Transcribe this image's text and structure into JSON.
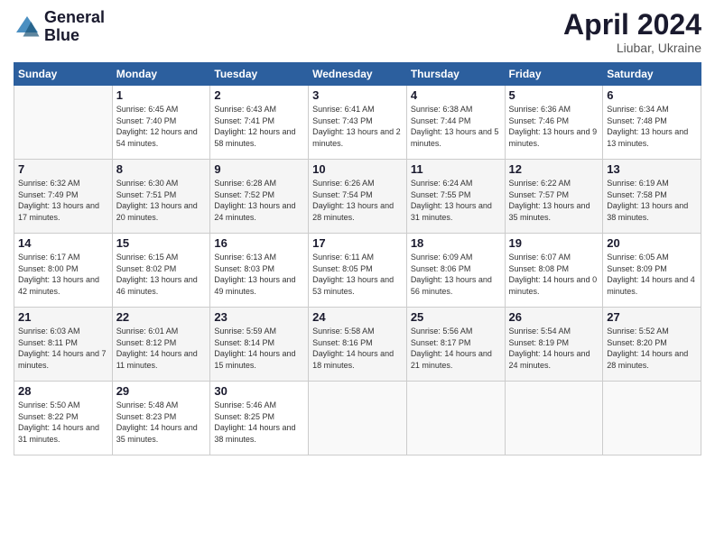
{
  "header": {
    "logo_line1": "General",
    "logo_line2": "Blue",
    "month_title": "April 2024",
    "location": "Liubar, Ukraine"
  },
  "weekdays": [
    "Sunday",
    "Monday",
    "Tuesday",
    "Wednesday",
    "Thursday",
    "Friday",
    "Saturday"
  ],
  "weeks": [
    [
      {
        "day": "",
        "sunrise": "",
        "sunset": "",
        "daylight": ""
      },
      {
        "day": "1",
        "sunrise": "Sunrise: 6:45 AM",
        "sunset": "Sunset: 7:40 PM",
        "daylight": "Daylight: 12 hours and 54 minutes."
      },
      {
        "day": "2",
        "sunrise": "Sunrise: 6:43 AM",
        "sunset": "Sunset: 7:41 PM",
        "daylight": "Daylight: 12 hours and 58 minutes."
      },
      {
        "day": "3",
        "sunrise": "Sunrise: 6:41 AM",
        "sunset": "Sunset: 7:43 PM",
        "daylight": "Daylight: 13 hours and 2 minutes."
      },
      {
        "day": "4",
        "sunrise": "Sunrise: 6:38 AM",
        "sunset": "Sunset: 7:44 PM",
        "daylight": "Daylight: 13 hours and 5 minutes."
      },
      {
        "day": "5",
        "sunrise": "Sunrise: 6:36 AM",
        "sunset": "Sunset: 7:46 PM",
        "daylight": "Daylight: 13 hours and 9 minutes."
      },
      {
        "day": "6",
        "sunrise": "Sunrise: 6:34 AM",
        "sunset": "Sunset: 7:48 PM",
        "daylight": "Daylight: 13 hours and 13 minutes."
      }
    ],
    [
      {
        "day": "7",
        "sunrise": "Sunrise: 6:32 AM",
        "sunset": "Sunset: 7:49 PM",
        "daylight": "Daylight: 13 hours and 17 minutes."
      },
      {
        "day": "8",
        "sunrise": "Sunrise: 6:30 AM",
        "sunset": "Sunset: 7:51 PM",
        "daylight": "Daylight: 13 hours and 20 minutes."
      },
      {
        "day": "9",
        "sunrise": "Sunrise: 6:28 AM",
        "sunset": "Sunset: 7:52 PM",
        "daylight": "Daylight: 13 hours and 24 minutes."
      },
      {
        "day": "10",
        "sunrise": "Sunrise: 6:26 AM",
        "sunset": "Sunset: 7:54 PM",
        "daylight": "Daylight: 13 hours and 28 minutes."
      },
      {
        "day": "11",
        "sunrise": "Sunrise: 6:24 AM",
        "sunset": "Sunset: 7:55 PM",
        "daylight": "Daylight: 13 hours and 31 minutes."
      },
      {
        "day": "12",
        "sunrise": "Sunrise: 6:22 AM",
        "sunset": "Sunset: 7:57 PM",
        "daylight": "Daylight: 13 hours and 35 minutes."
      },
      {
        "day": "13",
        "sunrise": "Sunrise: 6:19 AM",
        "sunset": "Sunset: 7:58 PM",
        "daylight": "Daylight: 13 hours and 38 minutes."
      }
    ],
    [
      {
        "day": "14",
        "sunrise": "Sunrise: 6:17 AM",
        "sunset": "Sunset: 8:00 PM",
        "daylight": "Daylight: 13 hours and 42 minutes."
      },
      {
        "day": "15",
        "sunrise": "Sunrise: 6:15 AM",
        "sunset": "Sunset: 8:02 PM",
        "daylight": "Daylight: 13 hours and 46 minutes."
      },
      {
        "day": "16",
        "sunrise": "Sunrise: 6:13 AM",
        "sunset": "Sunset: 8:03 PM",
        "daylight": "Daylight: 13 hours and 49 minutes."
      },
      {
        "day": "17",
        "sunrise": "Sunrise: 6:11 AM",
        "sunset": "Sunset: 8:05 PM",
        "daylight": "Daylight: 13 hours and 53 minutes."
      },
      {
        "day": "18",
        "sunrise": "Sunrise: 6:09 AM",
        "sunset": "Sunset: 8:06 PM",
        "daylight": "Daylight: 13 hours and 56 minutes."
      },
      {
        "day": "19",
        "sunrise": "Sunrise: 6:07 AM",
        "sunset": "Sunset: 8:08 PM",
        "daylight": "Daylight: 14 hours and 0 minutes."
      },
      {
        "day": "20",
        "sunrise": "Sunrise: 6:05 AM",
        "sunset": "Sunset: 8:09 PM",
        "daylight": "Daylight: 14 hours and 4 minutes."
      }
    ],
    [
      {
        "day": "21",
        "sunrise": "Sunrise: 6:03 AM",
        "sunset": "Sunset: 8:11 PM",
        "daylight": "Daylight: 14 hours and 7 minutes."
      },
      {
        "day": "22",
        "sunrise": "Sunrise: 6:01 AM",
        "sunset": "Sunset: 8:12 PM",
        "daylight": "Daylight: 14 hours and 11 minutes."
      },
      {
        "day": "23",
        "sunrise": "Sunrise: 5:59 AM",
        "sunset": "Sunset: 8:14 PM",
        "daylight": "Daylight: 14 hours and 15 minutes."
      },
      {
        "day": "24",
        "sunrise": "Sunrise: 5:58 AM",
        "sunset": "Sunset: 8:16 PM",
        "daylight": "Daylight: 14 hours and 18 minutes."
      },
      {
        "day": "25",
        "sunrise": "Sunrise: 5:56 AM",
        "sunset": "Sunset: 8:17 PM",
        "daylight": "Daylight: 14 hours and 21 minutes."
      },
      {
        "day": "26",
        "sunrise": "Sunrise: 5:54 AM",
        "sunset": "Sunset: 8:19 PM",
        "daylight": "Daylight: 14 hours and 24 minutes."
      },
      {
        "day": "27",
        "sunrise": "Sunrise: 5:52 AM",
        "sunset": "Sunset: 8:20 PM",
        "daylight": "Daylight: 14 hours and 28 minutes."
      }
    ],
    [
      {
        "day": "28",
        "sunrise": "Sunrise: 5:50 AM",
        "sunset": "Sunset: 8:22 PM",
        "daylight": "Daylight: 14 hours and 31 minutes."
      },
      {
        "day": "29",
        "sunrise": "Sunrise: 5:48 AM",
        "sunset": "Sunset: 8:23 PM",
        "daylight": "Daylight: 14 hours and 35 minutes."
      },
      {
        "day": "30",
        "sunrise": "Sunrise: 5:46 AM",
        "sunset": "Sunset: 8:25 PM",
        "daylight": "Daylight: 14 hours and 38 minutes."
      },
      {
        "day": "",
        "sunrise": "",
        "sunset": "",
        "daylight": ""
      },
      {
        "day": "",
        "sunrise": "",
        "sunset": "",
        "daylight": ""
      },
      {
        "day": "",
        "sunrise": "",
        "sunset": "",
        "daylight": ""
      },
      {
        "day": "",
        "sunrise": "",
        "sunset": "",
        "daylight": ""
      }
    ]
  ]
}
